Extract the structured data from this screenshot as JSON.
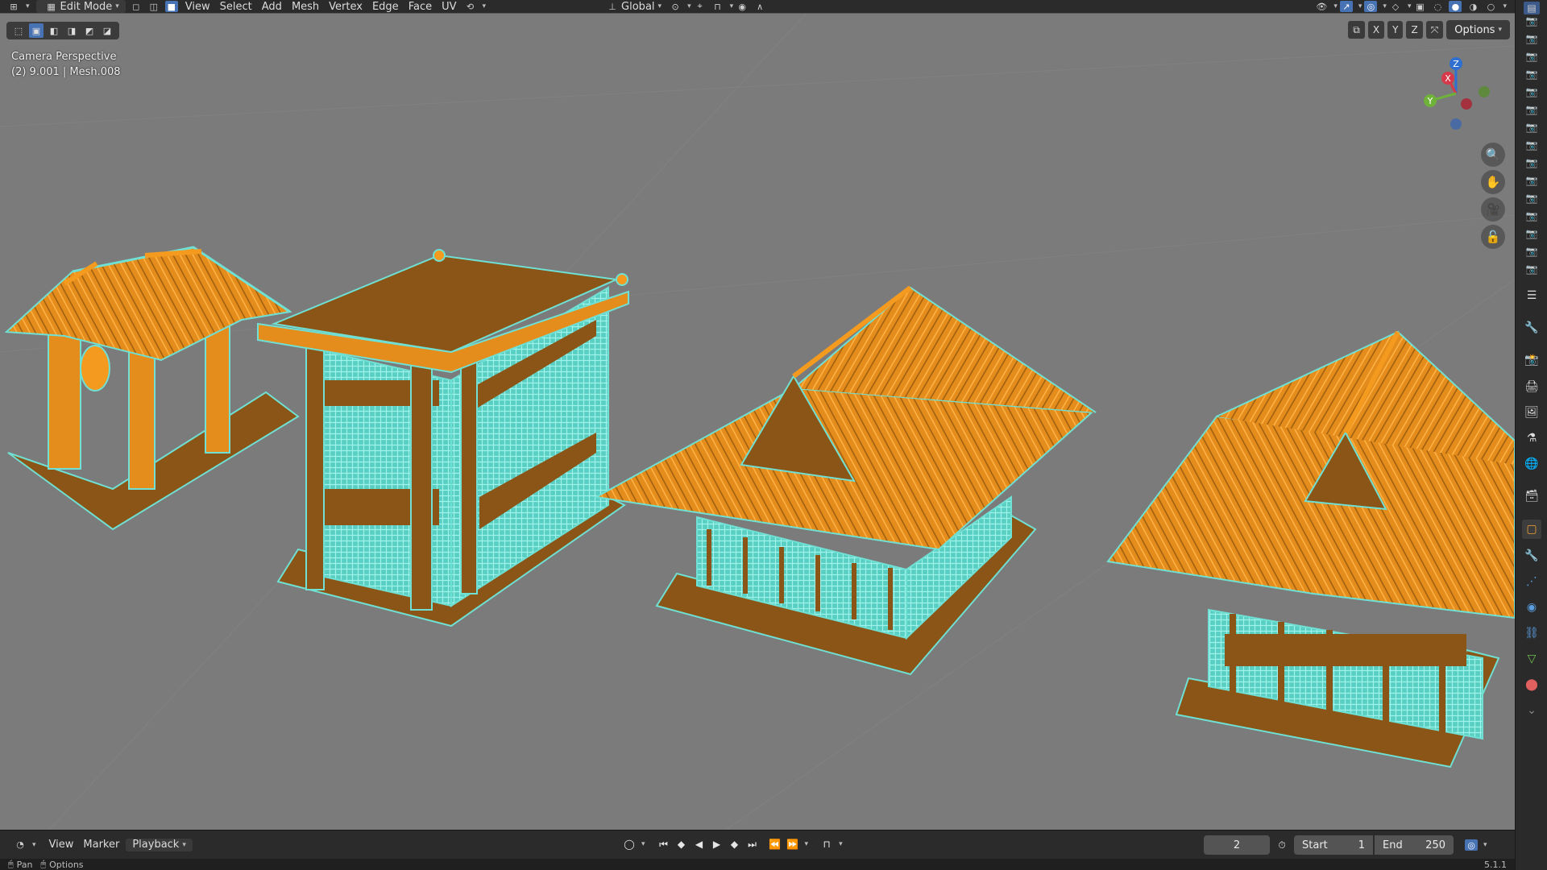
{
  "header": {
    "mode_label": "Edit Mode",
    "menus": [
      "View",
      "Select",
      "Add",
      "Mesh",
      "Vertex",
      "Edge",
      "Face",
      "UV"
    ],
    "transform_orientation": "Global"
  },
  "viewport": {
    "overlay_title": "Camera Perspective",
    "overlay_subtitle": "(2) 9.001 | Mesh.008",
    "axis_x": "X",
    "axis_y": "Y",
    "axis_z": "Z",
    "options_label": "Options",
    "gizmo": {
      "x": "X",
      "y": "Y",
      "z": "Z"
    }
  },
  "timeline": {
    "view_label": "View",
    "marker_label": "Marker",
    "playback_label": "Playback",
    "current_frame": "2",
    "start_label": "Start",
    "start_value": "1",
    "end_label": "End",
    "end_value": "250"
  },
  "statusbar": {
    "pan_label": "Pan",
    "options_label": "Options",
    "version": "5.1.1"
  },
  "colors": {
    "viewport_bg": "#7b7b7b",
    "mesh_fill": "#8a5516",
    "mesh_selected": "#f39a1f",
    "wire_edges": "#6fe0d3",
    "active_blue": "#4772b3"
  }
}
